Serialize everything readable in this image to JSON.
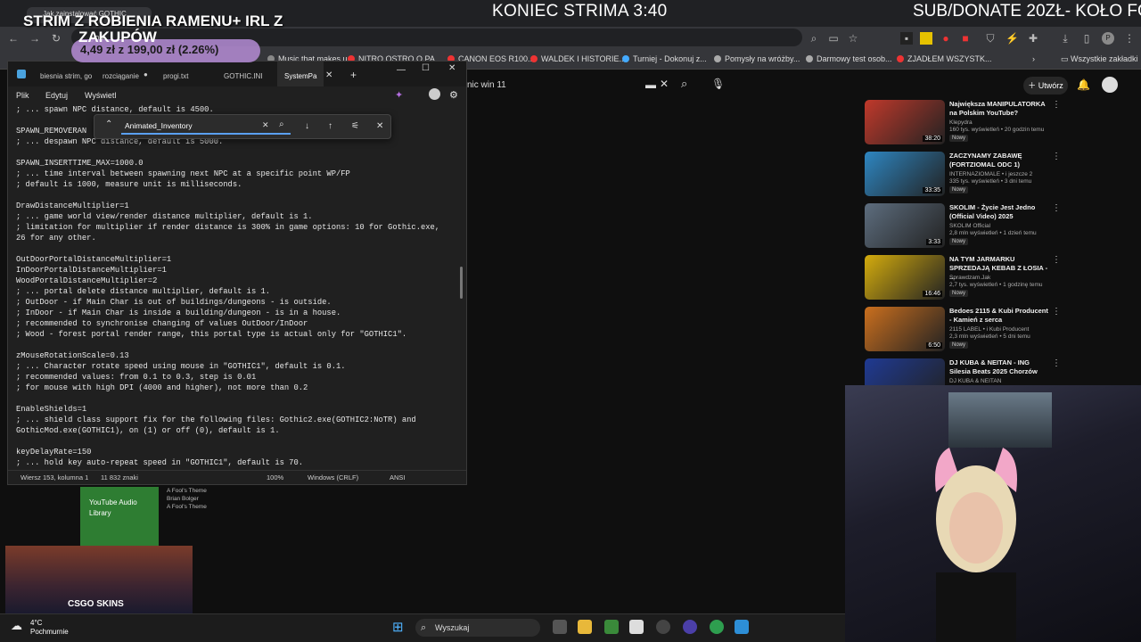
{
  "overlay": {
    "left_title": "STRIM Z ROBIENIA RAMENU+ IRL Z",
    "left_sub": "ZAKUPÓW",
    "price": "4,49 zł z 199,00 zł (2.26%)",
    "center": "KONIEC STRIMA 3:40",
    "right": "SUB/DONATE 20ZŁ- KOŁO FO"
  },
  "chrome": {
    "tab_title": "Jak zainstalować GOTHIC",
    "address_fragment": "you",
    "bookmarks": [
      {
        "label": "Music that makes u...",
        "color": "#888"
      },
      {
        "label": "NITRO OSTRO O PA...",
        "color": "#e33"
      },
      {
        "label": "CANON EOS R100...",
        "color": "#e33"
      },
      {
        "label": "WALDEK I HISTORIE...",
        "color": "#e33"
      },
      {
        "label": "Turniej - Dokonuj z...",
        "color": "#4af"
      },
      {
        "label": "Pomysły na wróżby...",
        "color": "#aaa"
      },
      {
        "label": "Darmowy test osob...",
        "color": "#aaa"
      },
      {
        "label": "ZJADŁEM WSZYSTK...",
        "color": "#e33"
      }
    ],
    "all_bookmarks": "Wszystkie zakładki"
  },
  "youtube": {
    "search_text": "nic win 11",
    "create_label": "Utwórz",
    "recommendations": [
      {
        "title": "Największa MANIPULATORKA na Polskim YouTube?",
        "channel": "Klepydra",
        "meta": "160 tys. wyświetleń • 20 godzin temu",
        "badge": "Nowy",
        "duration": "38:20",
        "color": "#c0392b"
      },
      {
        "title": "ZACZYNAMY ZABAWĘ (FORTZIOMAL ODC 1)",
        "channel": "INTERNAZIOMALE • i jeszcze 2",
        "meta": "335 tys. wyświetleń • 3 dni temu",
        "badge": "Nowy",
        "duration": "33:35",
        "color": "#2e86c1"
      },
      {
        "title": "SKOLIM - Życie Jest Jedno (Official Video) 2025",
        "channel": "SKOLIM Official",
        "meta": "2,8 mln wyświetleń • 1 dzień temu",
        "badge": "Nowy",
        "duration": "3:33",
        "color": "#5d6d7e"
      },
      {
        "title": "NA TYM JARMARKU SPRZEDAJĄ KEBAB Z ŁOSIA - ...",
        "channel": "Sprawdzam.Jak",
        "meta": "2,7 tys. wyświetleń • 1 godzinę temu",
        "badge": "Nowy",
        "duration": "16:46",
        "color": "#d4ac0d"
      },
      {
        "title": "Bedoes 2115 & Kubi Producent - Kamień z serca",
        "channel": "2115 LABEL • i Kubi Producent",
        "meta": "2,3 mln wyświetleń • 5 dni temu",
        "badge": "Nowy",
        "duration": "6:50",
        "color": "#ca6f1e"
      },
      {
        "title": "DJ KUBA & NEITAN - ING Silesia Beats 2025 Chorzów",
        "channel": "DJ KUBA & NEITAN",
        "meta": "",
        "badge": "",
        "duration": "",
        "color": "#1f3a93"
      }
    ]
  },
  "notepad": {
    "tabs": [
      "biesnia strim, go",
      "rozciąganie",
      "progi.txt",
      "GOTHIC.INI",
      "SystemPa"
    ],
    "menu": [
      "Plik",
      "Edytuj",
      "Wyświetl"
    ],
    "find_value": "Animated_Inventory",
    "text": "; ... spawn NPC distance, default is 4500.\n\nSPAWN_REMOVERAN\n; ... despawn NPC distance, default is 5000.\n\nSPAWN_INSERTTIME_MAX=1000.0\n; ... time interval between spawning next NPC at a specific point WP/FP\n; default is 1000, measure unit is milliseconds.\n\nDrawDistanceMultiplier=1\n; ... game world view/render distance multiplier, default is 1.\n; limitation for multiplier if render distance is 300% in game options: 10 for Gothic.exe,\n26 for any other.\n\nOutDoorPortalDistanceMultiplier=1\nInDoorPortalDistanceMultiplier=1\nWoodPortalDistanceMultiplier=2\n; ... portal delete distance multiplier, default is 1.\n; OutDoor - if Main Char is out of buildings/dungeons - is outside.\n; InDoor - if Main Char is inside a building/dungeon - is in a house.\n; recommended to synchronise changing of values OutDoor/InDoor\n; Wood - forest portal render range, this portal type is actual only for \"GOTHIC1\".\n\nzMouseRotationScale=0.13\n; ... Character rotate speed using mouse in \"GOTHIC1\", default is 0.1.\n; recommended values: from 0.1 to 0.3, step is 0.01\n; for mouse with high DPI (4000 and higher), not more than 0.2\n\nEnableShields=1\n; ... shield class support fix for the following files: Gothic2.exe(GOTHIC2:NoTR) and\nGothicMod.exe(GOTHIC1), on (1) or off (0), default is 1.\n\nkeyDelayRate=150\n; ... hold key auto-repeat speed in \"GOTHIC1\", default is 70.",
    "status": {
      "position": "Wiersz 153, kolumna 1",
      "chars": "11 832 znaki",
      "zoom": "100%",
      "eol": "Windows (CRLF)",
      "encoding": "ANSI"
    }
  },
  "music": {
    "audio_library": "YouTube Audio Library",
    "track": "A Fool's Theme",
    "artist": "Brian Bolger",
    "track2": "A Fool's Theme"
  },
  "promo": {
    "label": "CSGO SKINS"
  },
  "taskbar": {
    "temp": "4°C",
    "weather": "Pochmurnie",
    "search": "Wyszukaj"
  }
}
